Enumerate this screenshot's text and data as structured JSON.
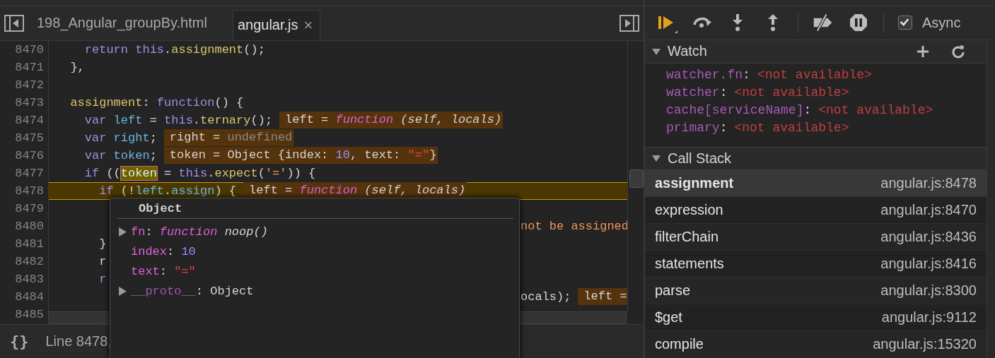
{
  "editor": {
    "tabs": [
      {
        "label": "198_Angular_groupBy.html",
        "selected": false,
        "closable": false
      },
      {
        "label": "angular.js",
        "selected": true,
        "closable": true,
        "close_glyph": "×"
      }
    ],
    "lines": [
      {
        "number": "8470",
        "kind": "code",
        "current": false,
        "tokens": [
          {
            "t": "    return",
            "kind": "kw"
          },
          {
            "t": " this",
            "kind": "kw"
          },
          {
            "t": ".",
            "kind": "plain"
          },
          {
            "t": "assignment",
            "kind": "fn"
          },
          {
            "t": "();",
            "kind": "plain"
          }
        ]
      },
      {
        "number": "8471",
        "kind": "code",
        "current": false,
        "tokens": [
          {
            "t": "  },",
            "kind": "plain"
          }
        ]
      },
      {
        "number": "8472",
        "kind": "code",
        "current": false
      },
      {
        "number": "8473",
        "kind": "code",
        "current": false,
        "tokens": [
          {
            "t": "  assignment",
            "kind": "fn"
          },
          {
            "t": ": ",
            "kind": "plain"
          },
          {
            "t": "function",
            "kind": "kw"
          },
          {
            "t": "() {",
            "kind": "plain"
          }
        ]
      },
      {
        "number": "8474",
        "kind": "code",
        "current": false,
        "tokens": [
          {
            "t": "    var",
            "kind": "kw"
          },
          {
            "t": " left",
            "kind": "var"
          },
          {
            "t": " = ",
            "kind": "plain"
          },
          {
            "t": "this",
            "kind": "kw"
          },
          {
            "t": ".",
            "kind": "plain"
          },
          {
            "t": "ternary",
            "kind": "fn"
          },
          {
            "t": "();",
            "kind": "plain"
          }
        ],
        "inline": [
          {
            "t": "left = ",
            "kind": "plain"
          },
          {
            "t": "function",
            "kind": "func"
          },
          {
            "t": " (self, locals)",
            "kind": "italic"
          }
        ]
      },
      {
        "number": "8475",
        "kind": "code",
        "current": false,
        "tokens": [
          {
            "t": "    var",
            "kind": "kw"
          },
          {
            "t": " right",
            "kind": "var"
          },
          {
            "t": ";",
            "kind": "plain"
          }
        ],
        "inline": [
          {
            "t": "right = ",
            "kind": "plain"
          },
          {
            "t": "undefined",
            "kind": "dim"
          }
        ]
      },
      {
        "number": "8476",
        "kind": "code",
        "current": false,
        "tokens": [
          {
            "t": "    var",
            "kind": "kw"
          },
          {
            "t": " token",
            "kind": "var"
          },
          {
            "t": ";",
            "kind": "plain"
          }
        ],
        "inline": [
          {
            "t": "token = Object {index: ",
            "kind": "plain"
          },
          {
            "t": "10",
            "kind": "num"
          },
          {
            "t": ", text: ",
            "kind": "plain"
          },
          {
            "t": "\"=\"",
            "kind": "str"
          },
          {
            "t": "}",
            "kind": "plain"
          }
        ]
      },
      {
        "number": "8477",
        "kind": "code",
        "current": false,
        "tokens": [
          {
            "t": "    if",
            "kind": "kw"
          },
          {
            "t": " ((",
            "kind": "plain"
          },
          {
            "t": "token",
            "kind": "hover"
          },
          {
            "t": " = ",
            "kind": "plain"
          },
          {
            "t": "this",
            "kind": "kw"
          },
          {
            "t": ".",
            "kind": "plain"
          },
          {
            "t": "expect",
            "kind": "fn"
          },
          {
            "t": "(",
            "kind": "plain"
          },
          {
            "t": "'='",
            "kind": "lit"
          },
          {
            "t": ")) {",
            "kind": "plain"
          }
        ]
      },
      {
        "number": "8478",
        "kind": "code",
        "current": true,
        "tokens": [
          {
            "t": "      if",
            "kind": "kw"
          },
          {
            "t": " (!",
            "kind": "plain"
          },
          {
            "t": "left",
            "kind": "var"
          },
          {
            "t": ".",
            "kind": "plain"
          },
          {
            "t": "assign",
            "kind": "var"
          },
          {
            "t": ") {",
            "kind": "plain"
          }
        ],
        "inline": [
          {
            "t": "left = ",
            "kind": "plain"
          },
          {
            "t": "function",
            "kind": "func"
          },
          {
            "t": " (self, locals)",
            "kind": "italic"
          }
        ]
      },
      {
        "number": "8479",
        "kind": "covered",
        "current": false
      },
      {
        "number": "8480",
        "kind": "covered",
        "current": false,
        "right": [
          {
            "t": "not be assigned",
            "kind": "lit"
          }
        ]
      },
      {
        "number": "8481",
        "kind": "covered",
        "current": false,
        "left": [
          {
            "t": "      }",
            "kind": "plain"
          }
        ]
      },
      {
        "number": "8482",
        "kind": "covered",
        "current": false,
        "left": [
          {
            "t": "      r",
            "kind": "plain"
          }
        ]
      },
      {
        "number": "8483",
        "kind": "covered",
        "current": false,
        "left": [
          {
            "t": "      r",
            "kind": "kw"
          }
        ]
      },
      {
        "number": "8484",
        "kind": "covered",
        "current": false,
        "right": [
          {
            "t": "ocals);",
            "kind": "plain"
          }
        ],
        "inline": [
          {
            "t": "left =",
            "kind": "plain"
          }
        ]
      },
      {
        "number": "8485",
        "kind": "covered",
        "current": false
      }
    ]
  },
  "popover": {
    "title": "Object",
    "properties": [
      {
        "name": "fn",
        "expandable": true,
        "enumerable": true,
        "value": [
          {
            "t": ": ",
            "kind": "plain"
          },
          {
            "t": "function",
            "kind": "func"
          },
          {
            "t": " noop()",
            "kind": "italic"
          }
        ]
      },
      {
        "name": "index",
        "expandable": false,
        "enumerable": true,
        "value": [
          {
            "t": ": ",
            "kind": "plain"
          },
          {
            "t": "10",
            "kind": "num"
          }
        ]
      },
      {
        "name": "text",
        "expandable": false,
        "enumerable": true,
        "value": [
          {
            "t": ": ",
            "kind": "plain"
          },
          {
            "t": "\"=\"",
            "kind": "str"
          }
        ]
      },
      {
        "name": "__proto__",
        "expandable": true,
        "enumerable": false,
        "value": [
          {
            "t": ": ",
            "kind": "plain"
          },
          {
            "t": "Object",
            "kind": "plain"
          }
        ]
      }
    ]
  },
  "status_bar": {
    "pretty_print": "{}",
    "position": "Line 8478,"
  },
  "debugger": {
    "toolbar": [
      {
        "kind": "resume"
      },
      {
        "kind": "step-over"
      },
      {
        "kind": "step-into"
      },
      {
        "kind": "step-out"
      },
      {
        "kind": "sep"
      },
      {
        "kind": "deactivate"
      },
      {
        "kind": "pause-exceptions"
      },
      {
        "kind": "sep"
      }
    ],
    "async": {
      "label": "Async",
      "checked": true
    },
    "watch": {
      "title": "Watch",
      "expanded": true,
      "items": [
        {
          "expression": "watcher.fn",
          "separator": ":",
          "value": "<not available>"
        },
        {
          "expression": "watcher",
          "separator": ":",
          "value": "<not available>"
        },
        {
          "expression": "cache[serviceName]",
          "separator": ":",
          "value": "<not available>"
        },
        {
          "expression": "primary",
          "separator": ":",
          "value": "<not available>"
        }
      ]
    },
    "call_stack": {
      "title": "Call Stack",
      "expanded": true,
      "frames": [
        {
          "name": "assignment",
          "location": "angular.js:8478",
          "selected": true
        },
        {
          "name": "expression",
          "location": "angular.js:8470",
          "selected": false
        },
        {
          "name": "filterChain",
          "location": "angular.js:8436",
          "selected": false
        },
        {
          "name": "statements",
          "location": "angular.js:8416",
          "selected": false
        },
        {
          "name": "parse",
          "location": "angular.js:8300",
          "selected": false
        },
        {
          "name": "$get",
          "location": "angular.js:9112",
          "selected": false
        },
        {
          "name": "compile",
          "location": "angular.js:15320",
          "selected": false
        }
      ]
    }
  }
}
